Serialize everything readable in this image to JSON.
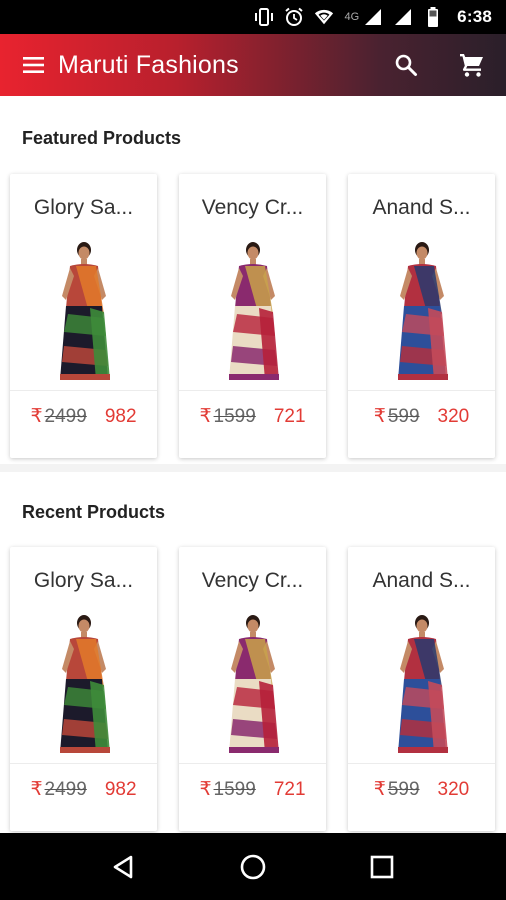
{
  "status_bar": {
    "network": "4G",
    "time": "6:38",
    "icons": [
      "vibrate-icon",
      "alarm-icon",
      "wifi-icon",
      "signal-icon",
      "signal-icon",
      "battery-icon"
    ]
  },
  "app_bar": {
    "title": "Maruti Fashions",
    "icons": [
      "menu-icon",
      "search-icon",
      "cart-icon"
    ],
    "colors": {
      "start": "#e8232f",
      "end": "#2a1f2a"
    }
  },
  "sections": {
    "featured": {
      "title": "Featured Products",
      "products": [
        {
          "name": "Glory Sa...",
          "currency": "₹",
          "old_price": "2499",
          "new_price": "982",
          "palette": [
            "#1c1a2b",
            "#b8473a",
            "#3e8c3a",
            "#e27a2a"
          ]
        },
        {
          "name": "Vency Cr...",
          "currency": "₹",
          "old_price": "1599",
          "new_price": "721",
          "palette": [
            "#eadcc4",
            "#8a2a6e",
            "#b6203a",
            "#c8a24a"
          ]
        },
        {
          "name": "Anand S...",
          "currency": "₹",
          "old_price": "599",
          "new_price": "320",
          "palette": [
            "#2d4f9a",
            "#b23040",
            "#c44a5a",
            "#283a70"
          ]
        }
      ]
    },
    "recent": {
      "title": "Recent Products",
      "products": [
        {
          "name": "Glory Sa...",
          "currency": "₹",
          "old_price": "2499",
          "new_price": "982",
          "palette": [
            "#1c1a2b",
            "#b8473a",
            "#3e8c3a",
            "#e27a2a"
          ]
        },
        {
          "name": "Vency Cr...",
          "currency": "₹",
          "old_price": "1599",
          "new_price": "721",
          "palette": [
            "#eadcc4",
            "#8a2a6e",
            "#b6203a",
            "#c8a24a"
          ]
        },
        {
          "name": "Anand S...",
          "currency": "₹",
          "old_price": "599",
          "new_price": "320",
          "palette": [
            "#2d4f9a",
            "#b23040",
            "#c44a5a",
            "#283a70"
          ]
        }
      ]
    }
  },
  "nav_bar": {
    "icons": [
      "back-icon",
      "home-icon",
      "recents-icon"
    ]
  }
}
